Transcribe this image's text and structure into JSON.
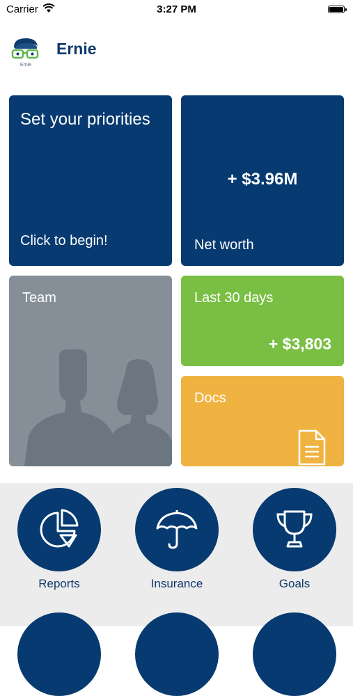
{
  "status_bar": {
    "carrier": "Carrier",
    "time": "3:27 PM"
  },
  "header": {
    "title": "Ernie",
    "logo_caption": "Ernie"
  },
  "tiles": {
    "priorities": {
      "title": "Set your priorities",
      "cta": "Click to begin!"
    },
    "net_worth": {
      "value": "+ $3.96M",
      "label": "Net worth"
    },
    "team": {
      "label": "Team"
    },
    "last_30_days": {
      "label": "Last 30 days",
      "value": "+ $3,803"
    },
    "docs": {
      "label": "Docs"
    }
  },
  "nav": {
    "items": [
      {
        "label": "Reports",
        "icon": "pie-chart-icon"
      },
      {
        "label": "Insurance",
        "icon": "umbrella-icon"
      },
      {
        "label": "Goals",
        "icon": "trophy-icon"
      }
    ]
  },
  "colors": {
    "navy": "#063a70",
    "green": "#79bf43",
    "orange": "#f0b341",
    "gray": "#868f97",
    "nav_bg": "#ececec"
  }
}
